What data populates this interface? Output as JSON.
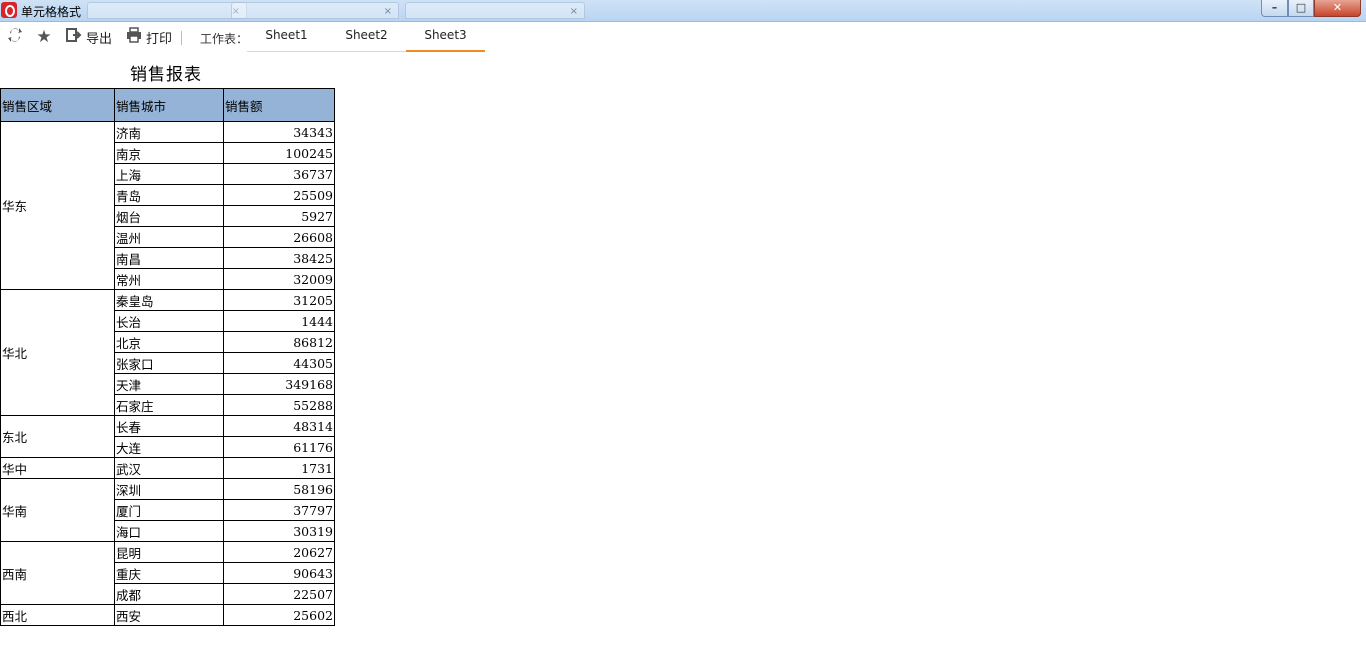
{
  "window": {
    "title": "单元格格式",
    "background_tabs": [
      "",
      "",
      ""
    ],
    "controls": {
      "minimize": "–",
      "maximize": "□",
      "close": "✕"
    }
  },
  "toolbar": {
    "refresh_icon": "refresh-icon",
    "favorite_icon": "star-icon",
    "export_label": "导出",
    "print_label": "打印",
    "sheet_label": "工作表：",
    "tabs": [
      {
        "label": "Sheet1",
        "active": false
      },
      {
        "label": "Sheet2",
        "active": false
      },
      {
        "label": "Sheet3",
        "active": true
      }
    ],
    "active_tab_color": "#f08a24"
  },
  "report": {
    "title": "销售报表",
    "header_color": "#95b3d7",
    "columns": [
      "销售区域",
      "销售城市",
      "销售额"
    ],
    "groups": [
      {
        "region": "华东",
        "rows": [
          {
            "city": "济南",
            "amount": "34343"
          },
          {
            "city": "南京",
            "amount": "100245"
          },
          {
            "city": "上海",
            "amount": "36737"
          },
          {
            "city": "青岛",
            "amount": "25509"
          },
          {
            "city": "烟台",
            "amount": "5927"
          },
          {
            "city": "温州",
            "amount": "26608"
          },
          {
            "city": "南昌",
            "amount": "38425"
          },
          {
            "city": "常州",
            "amount": "32009"
          }
        ]
      },
      {
        "region": "华北",
        "rows": [
          {
            "city": "秦皇岛",
            "amount": "31205"
          },
          {
            "city": "长治",
            "amount": "1444"
          },
          {
            "city": "北京",
            "amount": "86812"
          },
          {
            "city": "张家口",
            "amount": "44305"
          },
          {
            "city": "天津",
            "amount": "349168"
          },
          {
            "city": "石家庄",
            "amount": "55288"
          }
        ]
      },
      {
        "region": "东北",
        "rows": [
          {
            "city": "长春",
            "amount": "48314"
          },
          {
            "city": "大连",
            "amount": "61176"
          }
        ]
      },
      {
        "region": "华中",
        "rows": [
          {
            "city": "武汉",
            "amount": "1731"
          }
        ]
      },
      {
        "region": "华南",
        "rows": [
          {
            "city": "深圳",
            "amount": "58196"
          },
          {
            "city": "厦门",
            "amount": "37797"
          },
          {
            "city": "海口",
            "amount": "30319"
          }
        ]
      },
      {
        "region": "西南",
        "rows": [
          {
            "city": "昆明",
            "amount": "20627"
          },
          {
            "city": "重庆",
            "amount": "90643"
          },
          {
            "city": "成都",
            "amount": "22507"
          }
        ]
      },
      {
        "region": "西北",
        "rows": [
          {
            "city": "西安",
            "amount": "25602"
          }
        ]
      }
    ]
  }
}
